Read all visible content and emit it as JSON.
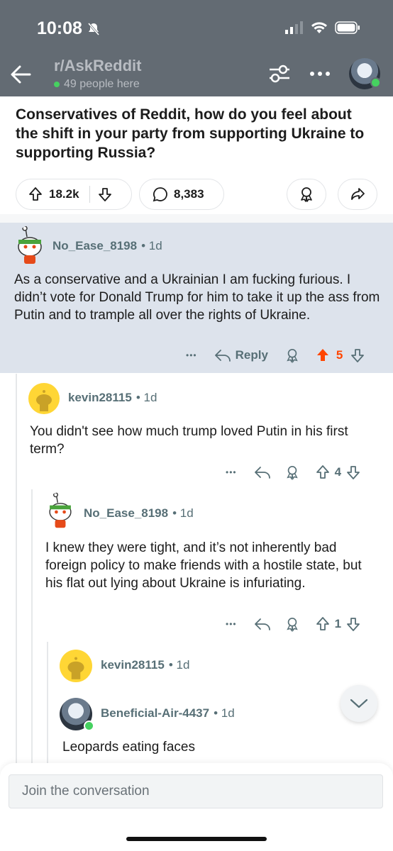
{
  "status": {
    "time": "10:08"
  },
  "nav": {
    "subreddit": "r/AskReddit",
    "online": "49 people here"
  },
  "post": {
    "title": "Conservatives of Reddit, how do you feel about the shift in your party from supporting Ukraine to supporting Russia?",
    "upvotes": "18.2k",
    "comments": "8,383"
  },
  "comments": [
    {
      "user": "No_Ease_8198",
      "age": "• 1d",
      "body": "As a conservative and a Ukrainian I am fucking furious. I didn’t vote for Donald Trump for him to take it up the ass from Putin and to trample all over the rights of Ukraine.",
      "reply_label": "Reply",
      "score": "5",
      "more": "•••"
    },
    {
      "user": "kevin28115",
      "age": "• 1d",
      "body": "You didn't see how much trump loved Putin in his first term?",
      "score": "4",
      "more": "•••"
    },
    {
      "user": "No_Ease_8198",
      "age": "• 1d",
      "body": "I knew they were tight, and it’s not inherently bad foreign policy to make friends with a hostile state, but his flat out lying about Ukraine is infuriating.",
      "score": "1",
      "more": "•••"
    },
    {
      "user": "kevin28115",
      "age": "• 1d"
    },
    {
      "user": "Beneficial-Air-4437",
      "age": "• 1d",
      "body": "Leopards eating faces"
    }
  ],
  "composer": {
    "placeholder": "Join the conversation"
  },
  "colors": {
    "upvote_active": "#ff4500",
    "header_bg": "#636b73",
    "highlight_bg": "#dde3ec"
  }
}
